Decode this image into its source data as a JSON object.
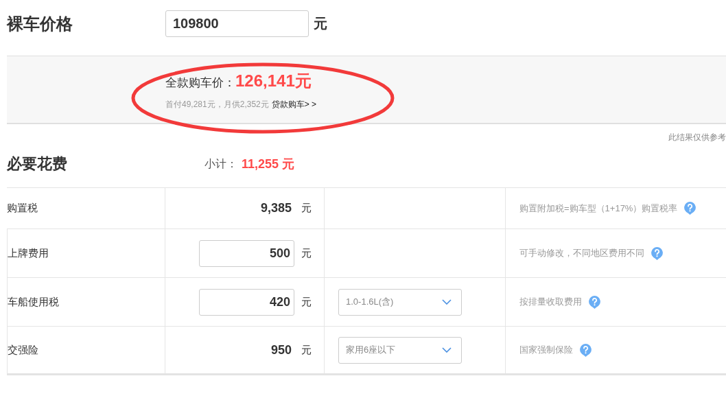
{
  "price": {
    "label": "裸车价格",
    "value": "109800",
    "unit": "元"
  },
  "summary": {
    "label": "全款购车价：",
    "total": "126,141元",
    "detail": "首付49,281元，月供2,352元",
    "loan_link": "贷款购车> >"
  },
  "note": "此结果仅供参考",
  "section": {
    "title": "必要花费",
    "subtotal_label": "小计：",
    "subtotal": "11,255 元"
  },
  "rows": [
    {
      "name": "购置税",
      "kind": "text",
      "value": "9,385",
      "unit": "元",
      "hint": "购置附加税=购车型（1+17%）购置税率"
    },
    {
      "name": "上牌费用",
      "kind": "input",
      "value": "500",
      "unit": "元",
      "hint": "可手动修改，不同地区费用不同"
    },
    {
      "name": "车船使用税",
      "kind": "input",
      "value": "420",
      "unit": "元",
      "select": "1.0-1.6L(含)",
      "hint": "按排量收取费用"
    },
    {
      "name": "交强险",
      "kind": "text",
      "value": "950",
      "unit": "元",
      "select": "家用6座以下",
      "hint": "国家强制保险"
    }
  ]
}
